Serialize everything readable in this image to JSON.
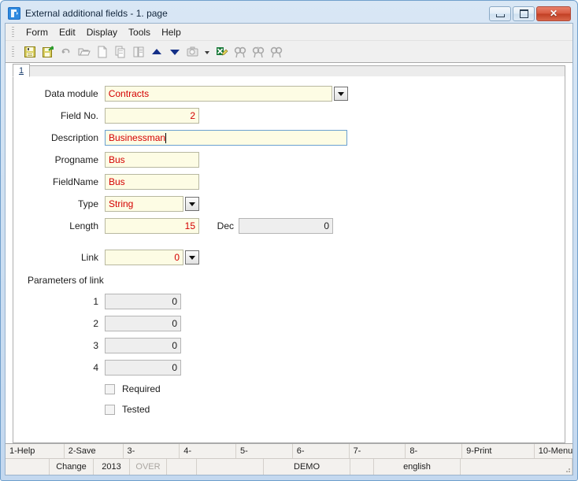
{
  "window": {
    "title": "External additional fields - 1. page",
    "app_icon": "app-icon",
    "minimize_label": "Minimize",
    "maximize_label": "Maximize",
    "close_label": "Close",
    "close_glyph": "✕"
  },
  "menubar": {
    "items": [
      {
        "label": "Form"
      },
      {
        "label": "Edit"
      },
      {
        "label": "Display"
      },
      {
        "label": "Tools"
      },
      {
        "label": "Help"
      }
    ]
  },
  "toolbar": {
    "buttons": [
      {
        "icon": "save-icon",
        "enabled": true
      },
      {
        "icon": "save-as-icon",
        "enabled": true
      },
      {
        "icon": "undo-icon",
        "enabled": false
      },
      {
        "icon": "open-folder-icon",
        "enabled": false
      },
      {
        "icon": "new-document-icon",
        "enabled": false
      },
      {
        "icon": "copy-icon",
        "enabled": false
      },
      {
        "icon": "paste-icon",
        "enabled": false
      },
      {
        "icon": "arrow-up-icon",
        "enabled": true
      },
      {
        "icon": "arrow-down-icon",
        "enabled": true
      },
      {
        "icon": "camera-icon",
        "enabled": false
      },
      {
        "icon": "dropdown-arrow-icon",
        "enabled": true
      },
      {
        "icon": "excel-export-icon",
        "enabled": true
      },
      {
        "icon": "find-icon",
        "enabled": false
      },
      {
        "icon": "find-next-icon",
        "enabled": false
      },
      {
        "icon": "find-all-icon",
        "enabled": false
      }
    ]
  },
  "tabs": {
    "active": "1",
    "items": [
      {
        "label": "1"
      }
    ]
  },
  "form": {
    "fields": {
      "data_module": {
        "label": "Data module",
        "value": "Contracts",
        "has_dropdown": true
      },
      "field_no": {
        "label": "Field No.",
        "value": "2"
      },
      "description": {
        "label": "Description",
        "value": "Businessman",
        "focused": true
      },
      "progname": {
        "label": "Progname",
        "value": "Bus"
      },
      "fieldname": {
        "label": "FieldName",
        "value": "Bus"
      },
      "type": {
        "label": "Type",
        "value": "String",
        "has_dropdown": true
      },
      "length": {
        "label": "Length",
        "value": "15"
      },
      "dec": {
        "label": "Dec",
        "value": "0",
        "disabled": true
      },
      "link": {
        "label": "Link",
        "value": "0",
        "has_dropdown": true
      }
    },
    "parameters_of_link": {
      "label": "Parameters of link",
      "rows": [
        {
          "label": "1",
          "value": "0"
        },
        {
          "label": "2",
          "value": "0"
        },
        {
          "label": "3",
          "value": "0"
        },
        {
          "label": "4",
          "value": "0"
        }
      ]
    },
    "checkboxes": [
      {
        "label": "Required",
        "checked": false
      },
      {
        "label": "Tested",
        "checked": false
      }
    ]
  },
  "function_keys": [
    {
      "label": "1-Help"
    },
    {
      "label": "2-Save"
    },
    {
      "label": "3-"
    },
    {
      "label": "4-"
    },
    {
      "label": "5-"
    },
    {
      "label": "6-"
    },
    {
      "label": "7-"
    },
    {
      "label": "8-"
    },
    {
      "label": "9-Print"
    },
    {
      "label": "10-Menu"
    }
  ],
  "statusbar": {
    "segments": [
      {
        "label": "",
        "name": "status-blank-1"
      },
      {
        "label": "Change",
        "name": "status-mode"
      },
      {
        "label": "2013",
        "name": "status-year"
      },
      {
        "label": "OVER",
        "name": "status-overwrite",
        "dim": true
      },
      {
        "label": "",
        "name": "status-blank-2"
      },
      {
        "label": "",
        "name": "status-blank-3"
      },
      {
        "label": "DEMO",
        "name": "status-client"
      },
      {
        "label": "",
        "name": "status-blank-4"
      },
      {
        "label": "english",
        "name": "status-language"
      },
      {
        "label": "",
        "name": "status-blank-5"
      }
    ]
  },
  "colors": {
    "field_background": "#FDFCE4",
    "field_text": "#D40000",
    "disabled_background": "#EEEEEE",
    "accent": "#C3D8EF"
  }
}
